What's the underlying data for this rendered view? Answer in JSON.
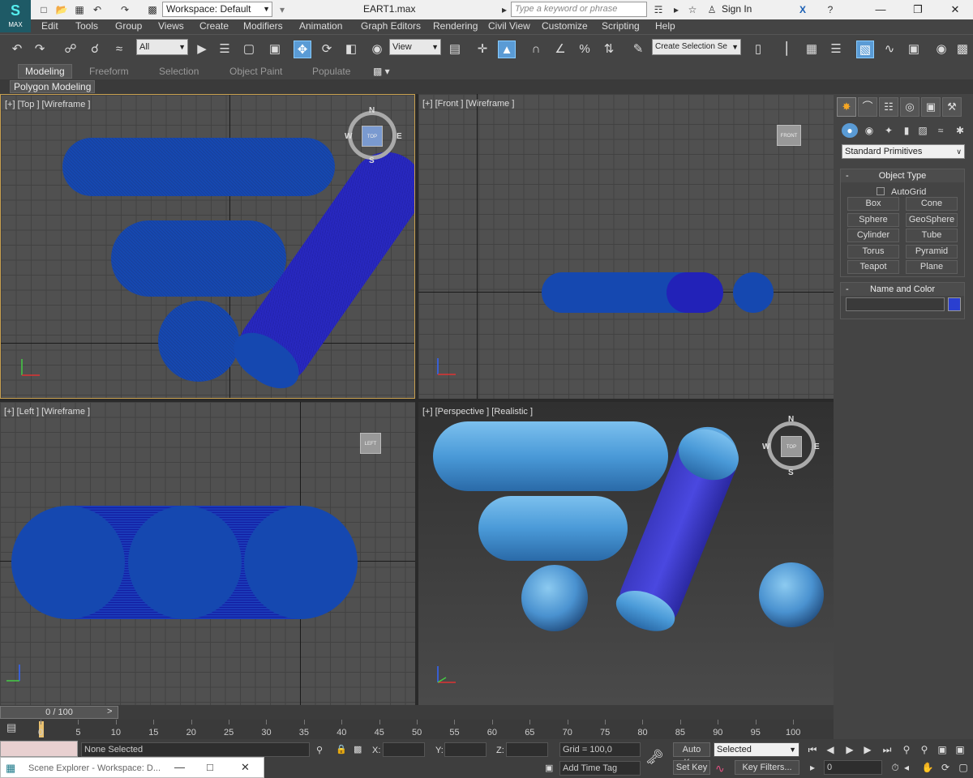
{
  "app": {
    "logo_label": "MAX",
    "workspace": "Workspace: Default",
    "file_title": "EART1.max",
    "search_placeholder": "Type a keyword or phrase",
    "sign_in": "Sign In"
  },
  "menu": [
    "Edit",
    "Tools",
    "Group",
    "Views",
    "Create",
    "Modifiers",
    "Animation",
    "Graph Editors",
    "Rendering",
    "Civil View",
    "Customize",
    "Scripting",
    "Help"
  ],
  "toolbar": {
    "filter": "All",
    "ref_coord": "View",
    "named_selection_placeholder": "Create Selection Se"
  },
  "ribbon": {
    "tabs": [
      "Modeling",
      "Freeform",
      "Selection",
      "Object Paint",
      "Populate"
    ],
    "active_tab": "Modeling",
    "panel": "Polygon Modeling"
  },
  "viewports": {
    "top": {
      "label": "[+] [Top ] [Wireframe ]",
      "cube": "TOP"
    },
    "front": {
      "label": "[+] [Front ] [Wireframe ]",
      "cube": "FRONT"
    },
    "left": {
      "label": "[+] [Left ] [Wireframe ]",
      "cube": "LEFT"
    },
    "perspective": {
      "label": "[+] [Perspective ] [Realistic ]",
      "cube": "TOP"
    },
    "compass": {
      "n": "N",
      "s": "S",
      "e": "E",
      "w": "W"
    }
  },
  "command_panel": {
    "category": "Standard Primitives",
    "object_type": {
      "title": "Object Type",
      "autogrid": "AutoGrid",
      "buttons": [
        "Box",
        "Cone",
        "Sphere",
        "GeoSphere",
        "Cylinder",
        "Tube",
        "Torus",
        "Pyramid",
        "Teapot",
        "Plane"
      ]
    },
    "name_and_color": {
      "title": "Name and Color",
      "color": "#2a3fd0"
    }
  },
  "timeline": {
    "frame": "0 / 100",
    "ticks": [
      "0",
      "5",
      "10",
      "15",
      "20",
      "25",
      "30",
      "35",
      "40",
      "45",
      "50",
      "55",
      "60",
      "65",
      "70",
      "75",
      "80",
      "85",
      "90",
      "95",
      "100"
    ]
  },
  "status": {
    "selection": "None Selected",
    "x_label": "X:",
    "y_label": "Y:",
    "z_label": "Z:",
    "grid": "Grid = 100,0",
    "add_time_tag": "Add Time Tag",
    "auto_key": "Auto Key",
    "selected": "Selected",
    "set_key": "Set Key",
    "key_filters": "Key Filters...",
    "frame_field": "0",
    "scene_explorer": "Scene Explorer - Workspace: D..."
  },
  "colors": {
    "object_blue": "#1548b0",
    "object_indigo": "#2a2ac8",
    "realistic_blue": "#4a9ad8",
    "active_viewport_border": "#c8a050"
  }
}
